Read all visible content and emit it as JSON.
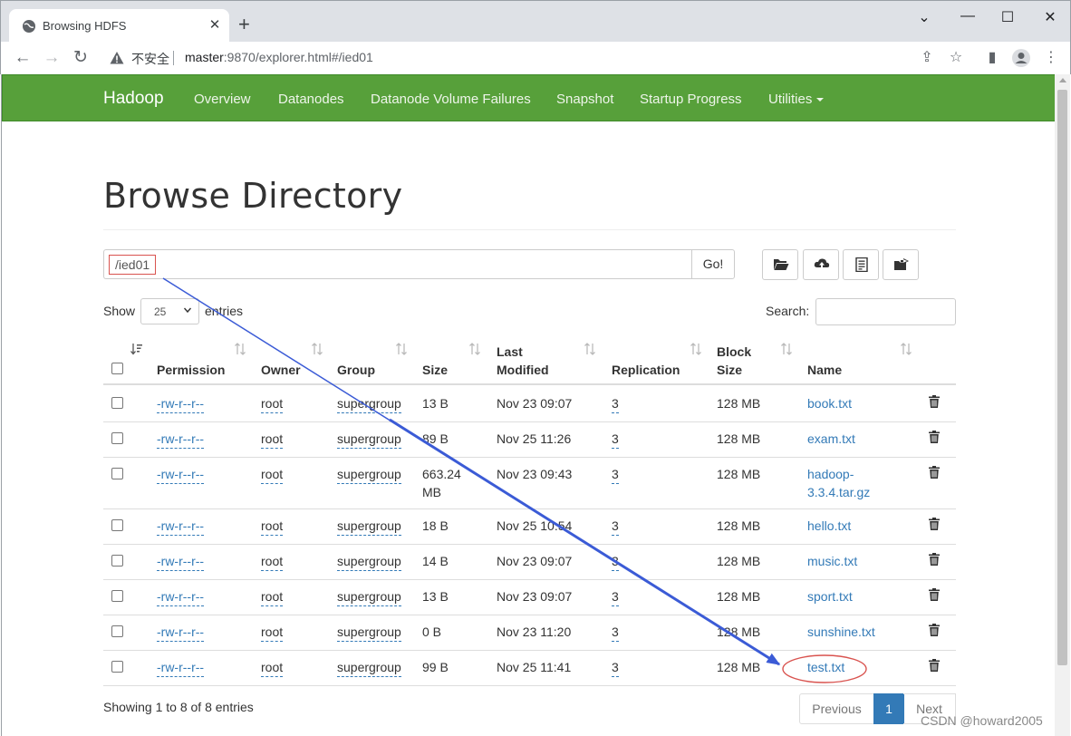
{
  "browser": {
    "tab_title": "Browsing HDFS",
    "insecure_label": "不安全",
    "url_host": "master",
    "url_rest": ":9870/explorer.html#/ied01"
  },
  "navbar": {
    "brand": "Hadoop",
    "links": [
      "Overview",
      "Datanodes",
      "Datanode Volume Failures",
      "Snapshot",
      "Startup Progress",
      "Utilities"
    ]
  },
  "page": {
    "title": "Browse Directory",
    "path_value": "/ied01",
    "go_label": "Go!",
    "show_label": "Show",
    "entries_value": "25",
    "entries_label": "entries",
    "search_label": "Search:",
    "search_value": ""
  },
  "table": {
    "headers": {
      "permission": "Permission",
      "owner": "Owner",
      "group": "Group",
      "size": "Size",
      "last_modified_1": "Last",
      "last_modified_2": "Modified",
      "replication": "Replication",
      "block_size_1": "Block",
      "block_size_2": "Size",
      "name": "Name"
    },
    "rows": [
      {
        "permission": "-rw-r--r--",
        "owner": "root",
        "group": "supergroup",
        "size": "13 B",
        "size2": "",
        "modified": "Nov 23 09:07",
        "replication": "3",
        "block": "128 MB",
        "name": "book.txt",
        "name2": ""
      },
      {
        "permission": "-rw-r--r--",
        "owner": "root",
        "group": "supergroup",
        "size": "89 B",
        "size2": "",
        "modified": "Nov 25 11:26",
        "replication": "3",
        "block": "128 MB",
        "name": "exam.txt",
        "name2": ""
      },
      {
        "permission": "-rw-r--r--",
        "owner": "root",
        "group": "supergroup",
        "size": "663.24",
        "size2": "MB",
        "modified": "Nov 23 09:43",
        "replication": "3",
        "block": "128 MB",
        "name": "hadoop-",
        "name2": "3.3.4.tar.gz"
      },
      {
        "permission": "-rw-r--r--",
        "owner": "root",
        "group": "supergroup",
        "size": "18 B",
        "size2": "",
        "modified": "Nov 25 10:54",
        "replication": "3",
        "block": "128 MB",
        "name": "hello.txt",
        "name2": ""
      },
      {
        "permission": "-rw-r--r--",
        "owner": "root",
        "group": "supergroup",
        "size": "14 B",
        "size2": "",
        "modified": "Nov 23 09:07",
        "replication": "3",
        "block": "128 MB",
        "name": "music.txt",
        "name2": ""
      },
      {
        "permission": "-rw-r--r--",
        "owner": "root",
        "group": "supergroup",
        "size": "13 B",
        "size2": "",
        "modified": "Nov 23 09:07",
        "replication": "3",
        "block": "128 MB",
        "name": "sport.txt",
        "name2": ""
      },
      {
        "permission": "-rw-r--r--",
        "owner": "root",
        "group": "supergroup",
        "size": "0 B",
        "size2": "",
        "modified": "Nov 23 11:20",
        "replication": "3",
        "block": "128 MB",
        "name": "sunshine.txt",
        "name2": ""
      },
      {
        "permission": "-rw-r--r--",
        "owner": "root",
        "group": "supergroup",
        "size": "99 B",
        "size2": "",
        "modified": "Nov 25 11:41",
        "replication": "3",
        "block": "128 MB",
        "name": "test.txt",
        "name2": ""
      }
    ]
  },
  "footer": {
    "info": "Showing 1 to 8 of 8 entries",
    "prev": "Previous",
    "page": "1",
    "next": "Next"
  },
  "watermark": "CSDN @howard2005",
  "colors": {
    "navbar": "#57a03a",
    "link": "#337ab7",
    "annotation_arrow": "#3b5bd6",
    "annotation_box": "#d9534f"
  }
}
